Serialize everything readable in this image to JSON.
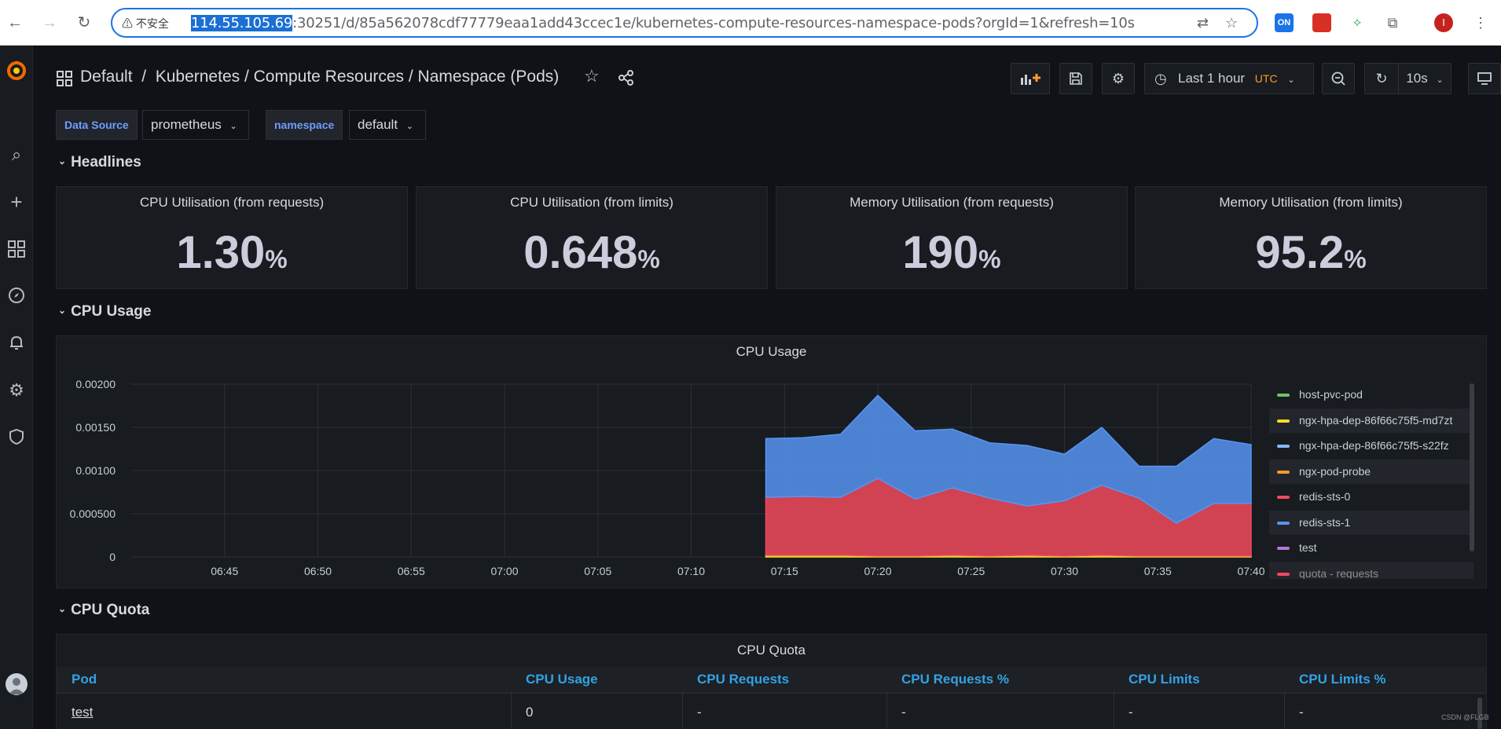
{
  "browser": {
    "security_label": "不安全",
    "url_host_selected": "114.55.105.69",
    "url_rest": ":30251/d/85a562078cdf77779eaa1add43ccec1e/kubernetes-compute-resources-namespace-pods?orgId=1&refresh=10s",
    "ext_badge": "ON",
    "profile_initial": "I"
  },
  "header": {
    "breadcrumb": "Default  /  Kubernetes / Compute Resources / Namespace (Pods)",
    "time_range": "Last 1 hour",
    "timezone": "UTC",
    "refresh_interval": "10s"
  },
  "variables": [
    {
      "label": "Data Source",
      "value": "prometheus"
    },
    {
      "label": "namespace",
      "value": "default"
    }
  ],
  "rows": {
    "headlines": "Headlines",
    "cpu_usage": "CPU Usage",
    "cpu_quota": "CPU Quota"
  },
  "stats": [
    {
      "title": "CPU Utilisation (from requests)",
      "value": "1.30",
      "unit": "%"
    },
    {
      "title": "CPU Utilisation (from limits)",
      "value": "0.648",
      "unit": "%"
    },
    {
      "title": "Memory Utilisation (from requests)",
      "value": "190",
      "unit": "%"
    },
    {
      "title": "Memory Utilisation (from limits)",
      "value": "95.2",
      "unit": "%"
    }
  ],
  "cpu_panel_title": "CPU Usage",
  "chart_data": {
    "type": "area",
    "title": "CPU Usage",
    "x": [
      "07:14",
      "07:16",
      "07:18",
      "07:20",
      "07:22",
      "07:24",
      "07:26",
      "07:28",
      "07:30",
      "07:32",
      "07:34",
      "07:36",
      "07:38",
      "07:40"
    ],
    "xticks": [
      "06:45",
      "06:50",
      "06:55",
      "07:00",
      "07:05",
      "07:10",
      "07:15",
      "07:20",
      "07:25",
      "07:30",
      "07:35",
      "07:40"
    ],
    "yticks": [
      "0",
      "0.000500",
      "0.00100",
      "0.00150",
      "0.00200"
    ],
    "ylim": [
      0,
      0.002
    ],
    "stacked": true,
    "series": [
      {
        "name": "ngx-hpa-dep-86f66c75f5-md7zt",
        "color": "#fade2a",
        "values": [
          2e-05,
          2e-05,
          2e-05,
          1e-05,
          1e-05,
          2e-05,
          1e-05,
          2e-05,
          1e-05,
          2e-05,
          1e-05,
          1e-05,
          1e-05,
          1e-05
        ]
      },
      {
        "name": "redis-sts-0",
        "color": "#f2495c",
        "values": [
          0.00067,
          0.00068,
          0.00067,
          0.0009,
          0.00066,
          0.00078,
          0.00067,
          0.00057,
          0.00064,
          0.00081,
          0.00067,
          0.00038,
          0.00061,
          0.00061
        ]
      },
      {
        "name": "redis-sts-1",
        "color": "#5794f2",
        "values": [
          0.00068,
          0.00068,
          0.00073,
          0.00096,
          0.00079,
          0.00068,
          0.00064,
          0.0007,
          0.00054,
          0.00067,
          0.00037,
          0.00066,
          0.00075,
          0.00068
        ]
      }
    ],
    "legend": [
      {
        "name": "host-pvc-pod",
        "color": "#73bf69"
      },
      {
        "name": "ngx-hpa-dep-86f66c75f5-md7zt",
        "color": "#fade2a"
      },
      {
        "name": "ngx-hpa-dep-86f66c75f5-s22fz",
        "color": "#8ab8ff"
      },
      {
        "name": "ngx-pod-probe",
        "color": "#ff9830"
      },
      {
        "name": "redis-sts-0",
        "color": "#f2495c"
      },
      {
        "name": "redis-sts-1",
        "color": "#5794f2"
      },
      {
        "name": "test",
        "color": "#b877d9"
      },
      {
        "name": "quota - requests",
        "color": "#f2495c"
      }
    ]
  },
  "quota_table": {
    "title": "CPU Quota",
    "columns": [
      "Pod",
      "CPU Usage",
      "CPU Requests",
      "CPU Requests %",
      "CPU Limits",
      "CPU Limits %"
    ],
    "rows": [
      [
        "test",
        "0",
        "-",
        "-",
        "-",
        "-"
      ]
    ]
  },
  "watermark": "CSDN @FLGB"
}
